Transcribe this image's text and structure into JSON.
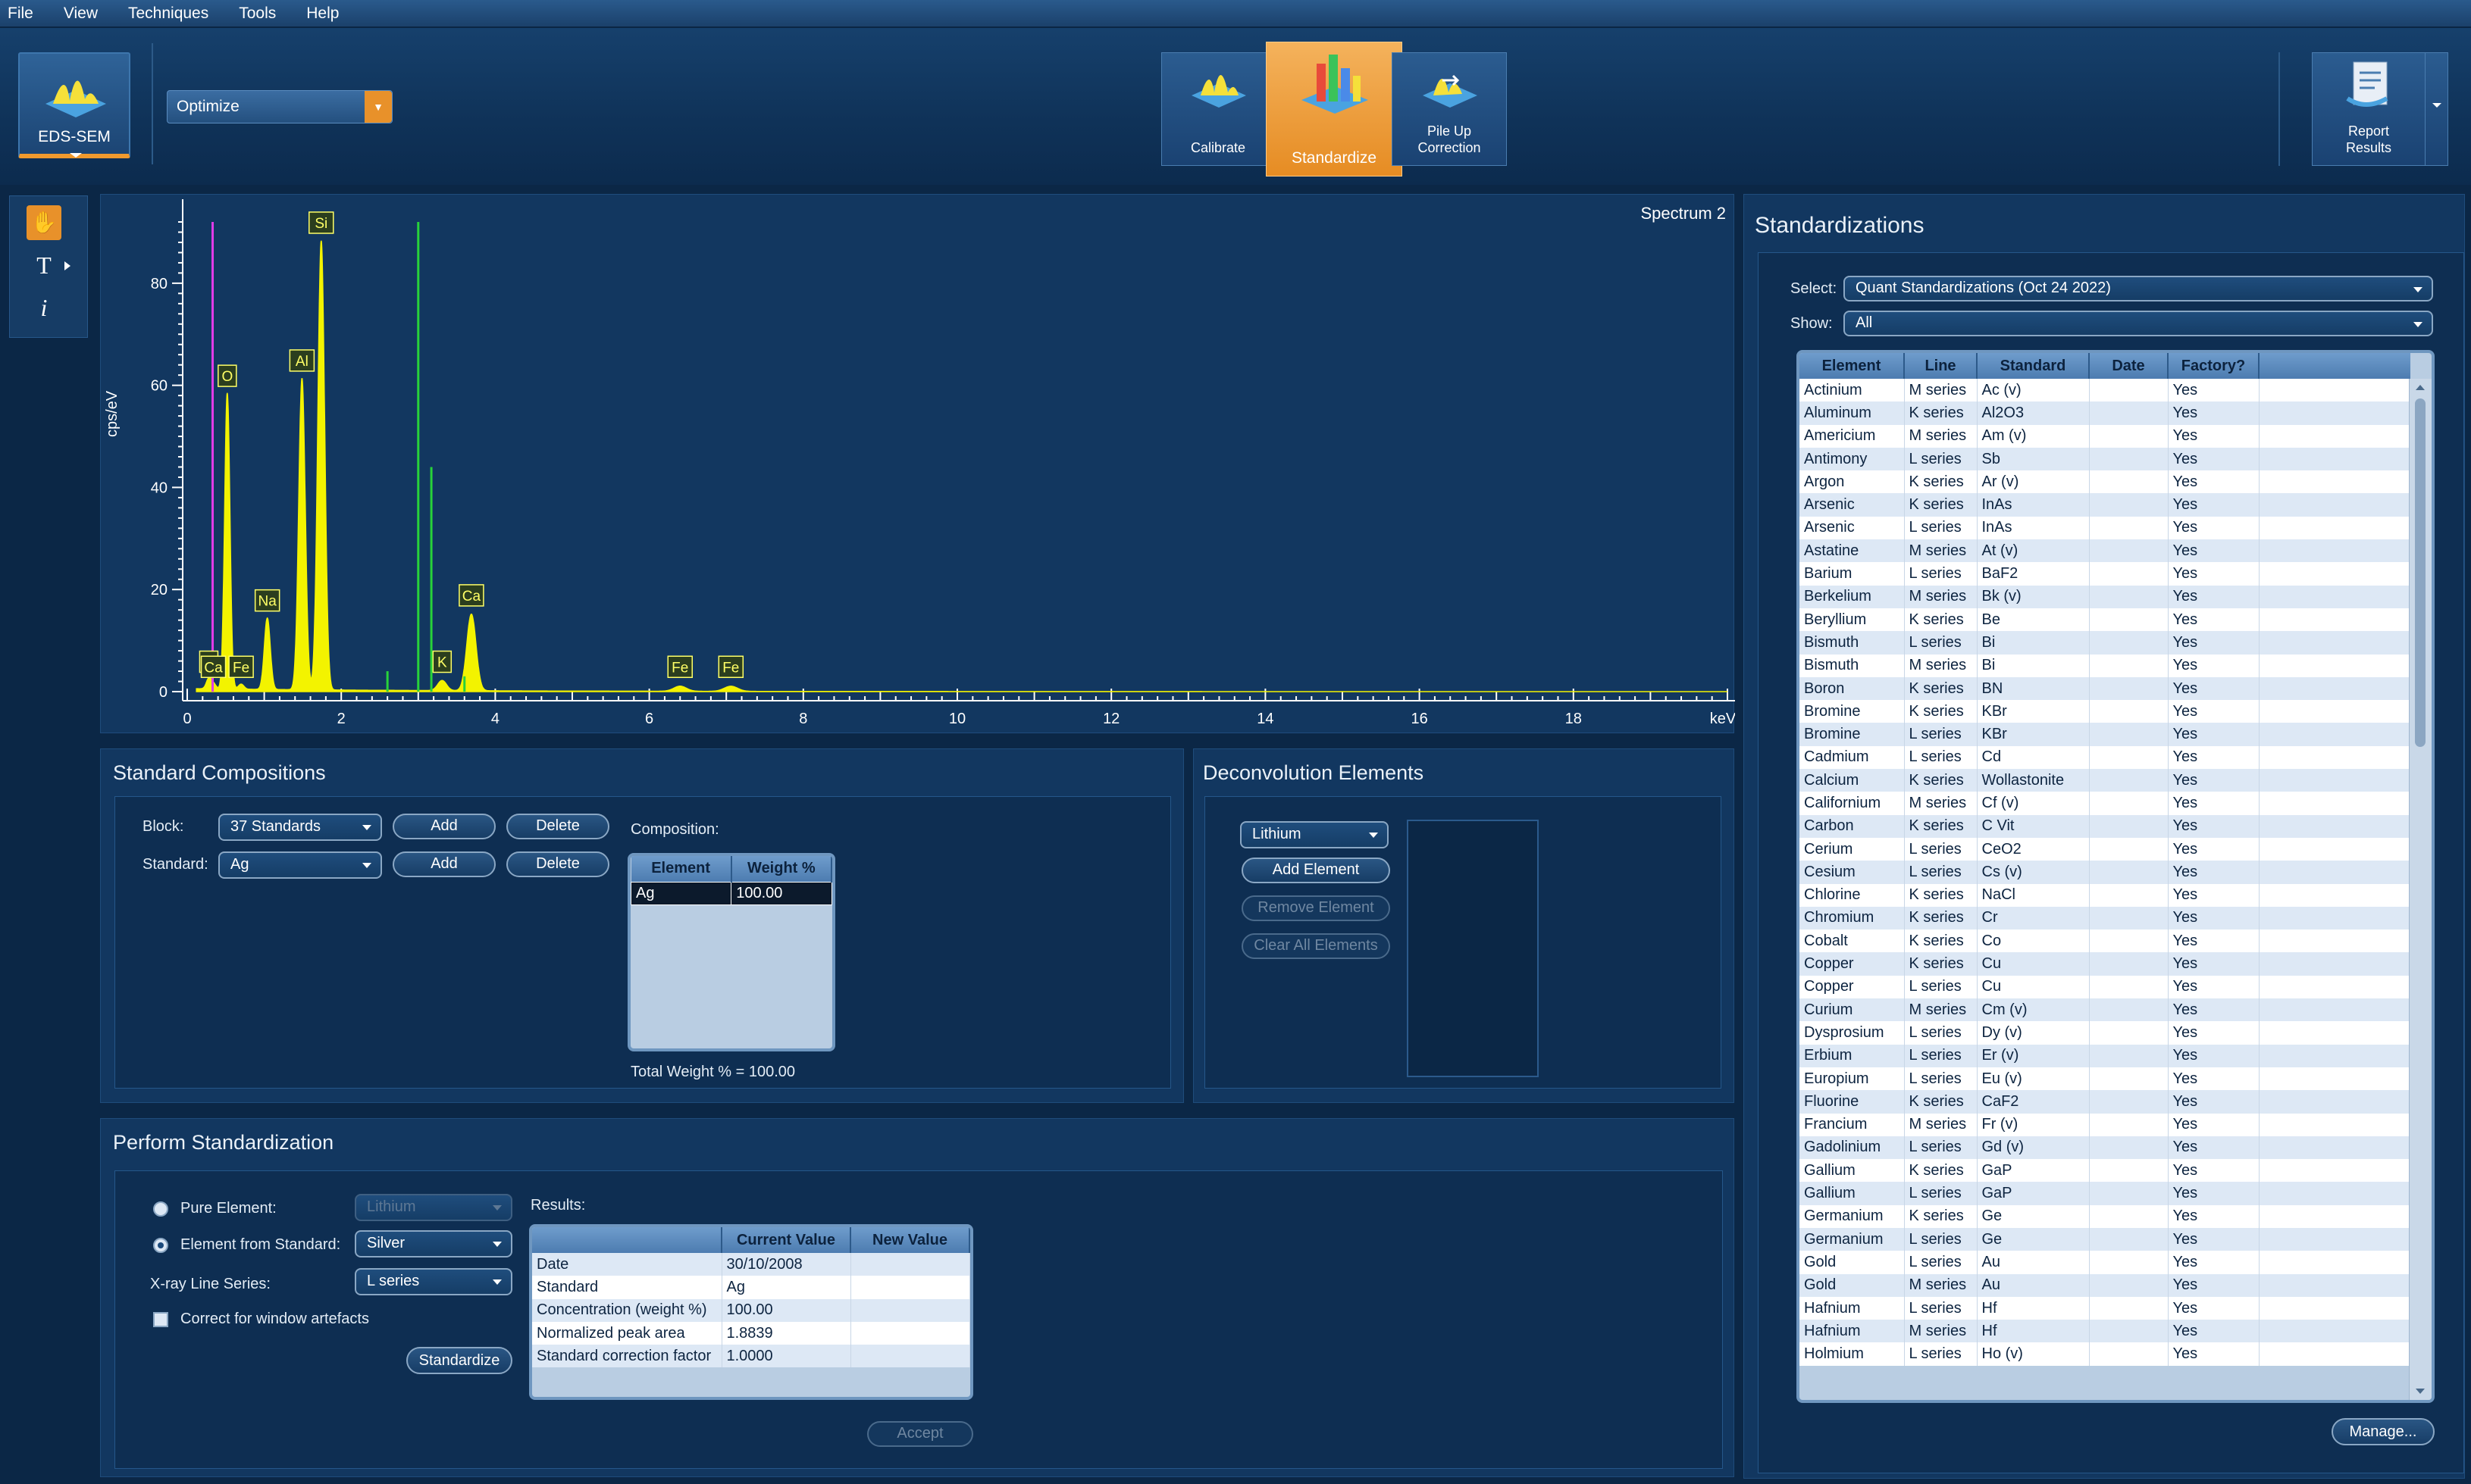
{
  "menu": [
    "File",
    "View",
    "Techniques",
    "Tools",
    "Help"
  ],
  "app_button": {
    "label": "EDS-SEM"
  },
  "optimize_combo": {
    "value": "Optimize"
  },
  "ribbon": {
    "calibrate": "Calibrate",
    "standardize": "Standardize",
    "pileup_line1": "Pile Up",
    "pileup_line2": "Correction",
    "report_line1": "Report",
    "report_line2": "Results"
  },
  "spectrum": {
    "title": "Spectrum 2",
    "ylabel": "cps/eV",
    "xunit": "keV",
    "xticks": [
      "0",
      "2",
      "4",
      "6",
      "8",
      "10",
      "12",
      "14",
      "16",
      "18"
    ],
    "yticks": [
      "0",
      "20",
      "40",
      "60",
      "80"
    ],
    "peak_labels": [
      "Si",
      "O",
      "Al",
      "Na",
      "Ca",
      "C",
      "Ca",
      "Fe",
      "K",
      "Fe",
      "Fe"
    ]
  },
  "chart_data": {
    "type": "line",
    "title": "Spectrum 2",
    "xlabel": "keV",
    "ylabel": "cps/eV",
    "xlim": [
      0,
      20
    ],
    "ylim": [
      0,
      92
    ],
    "peaks": [
      {
        "label": "C",
        "x": 0.28,
        "y": 2
      },
      {
        "label": "Ca",
        "x": 0.34,
        "y": 1
      },
      {
        "label": "O",
        "x": 0.52,
        "y": 58
      },
      {
        "label": "Fe",
        "x": 0.7,
        "y": 1
      },
      {
        "label": "Na",
        "x": 1.04,
        "y": 14
      },
      {
        "label": "Al",
        "x": 1.49,
        "y": 61
      },
      {
        "label": "Si",
        "x": 1.74,
        "y": 88
      },
      {
        "label": "K",
        "x": 3.31,
        "y": 2
      },
      {
        "label": "Ca",
        "x": 3.69,
        "y": 15
      },
      {
        "label": "Fe",
        "x": 6.4,
        "y": 1
      },
      {
        "label": "Fe",
        "x": 7.06,
        "y": 1
      }
    ],
    "marker_lines": [
      {
        "x": 0.33,
        "color": "#e23ce8",
        "y": 92
      },
      {
        "x": 3.0,
        "color": "#28d23a",
        "y": 92
      },
      {
        "x": 3.17,
        "color": "#28d23a",
        "y": 44
      },
      {
        "x": 2.6,
        "color": "#28d23a",
        "y": 4
      },
      {
        "x": 3.6,
        "color": "#28d23a",
        "y": 3
      }
    ]
  },
  "std_comp": {
    "title": "Standard Compositions",
    "block_label": "Block:",
    "block_value": "37 Standards",
    "standard_label": "Standard:",
    "standard_value": "Ag",
    "add": "Add",
    "delete": "Delete",
    "composition_label": "Composition:",
    "comp_headers": [
      "Element",
      "Weight %"
    ],
    "comp_rows": [
      [
        "Ag",
        "100.00"
      ]
    ],
    "total": "Total Weight % = 100.00"
  },
  "deconv": {
    "title": "Deconvolution Elements",
    "element_value": "Lithium",
    "add": "Add Element",
    "remove": "Remove Element",
    "clear": "Clear All Elements"
  },
  "perform": {
    "title": "Perform Standardization",
    "pure_label": "Pure Element:",
    "pure_value": "Lithium",
    "efs_label": "Element from Standard:",
    "efs_value": "Silver",
    "xray_label": "X-ray Line Series:",
    "xray_value": "L series",
    "correct_label": "Correct for window artefacts",
    "standardize_btn": "Standardize",
    "results_label": "Results:",
    "res_headers": [
      "",
      "Current Value",
      "New Value"
    ],
    "res_rows": [
      [
        "Date",
        "30/10/2008",
        ""
      ],
      [
        "Standard",
        "Ag",
        ""
      ],
      [
        "Concentration (weight %)",
        "100.00",
        ""
      ],
      [
        "Normalized peak area",
        "1.8839",
        ""
      ],
      [
        "Standard correction factor",
        "1.0000",
        ""
      ]
    ],
    "accept": "Accept"
  },
  "standardizations": {
    "title": "Standardizations",
    "select_label": "Select:",
    "select_value": "Quant Standardizations (Oct 24 2022)",
    "show_label": "Show:",
    "show_value": "All",
    "headers": [
      "Element",
      "Line",
      "Standard",
      "Date",
      "Factory?"
    ],
    "rows": [
      [
        "Actinium",
        "M series",
        "Ac (v)",
        "",
        "Yes"
      ],
      [
        "Aluminum",
        "K series",
        "Al2O3",
        "",
        "Yes"
      ],
      [
        "Americium",
        "M series",
        "Am (v)",
        "",
        "Yes"
      ],
      [
        "Antimony",
        "L series",
        "Sb",
        "",
        "Yes"
      ],
      [
        "Argon",
        "K series",
        "Ar (v)",
        "",
        "Yes"
      ],
      [
        "Arsenic",
        "K series",
        "InAs",
        "",
        "Yes"
      ],
      [
        "Arsenic",
        "L series",
        "InAs",
        "",
        "Yes"
      ],
      [
        "Astatine",
        "M series",
        "At (v)",
        "",
        "Yes"
      ],
      [
        "Barium",
        "L series",
        "BaF2",
        "",
        "Yes"
      ],
      [
        "Berkelium",
        "M series",
        "Bk (v)",
        "",
        "Yes"
      ],
      [
        "Beryllium",
        "K series",
        "Be",
        "",
        "Yes"
      ],
      [
        "Bismuth",
        "L series",
        "Bi",
        "",
        "Yes"
      ],
      [
        "Bismuth",
        "M series",
        "Bi",
        "",
        "Yes"
      ],
      [
        "Boron",
        "K series",
        "BN",
        "",
        "Yes"
      ],
      [
        "Bromine",
        "K series",
        "KBr",
        "",
        "Yes"
      ],
      [
        "Bromine",
        "L series",
        "KBr",
        "",
        "Yes"
      ],
      [
        "Cadmium",
        "L series",
        "Cd",
        "",
        "Yes"
      ],
      [
        "Calcium",
        "K series",
        "Wollastonite",
        "",
        "Yes"
      ],
      [
        "Californium",
        "M series",
        "Cf (v)",
        "",
        "Yes"
      ],
      [
        "Carbon",
        "K series",
        "C Vit",
        "",
        "Yes"
      ],
      [
        "Cerium",
        "L series",
        "CeO2",
        "",
        "Yes"
      ],
      [
        "Cesium",
        "L series",
        "Cs (v)",
        "",
        "Yes"
      ],
      [
        "Chlorine",
        "K series",
        "NaCl",
        "",
        "Yes"
      ],
      [
        "Chromium",
        "K series",
        "Cr",
        "",
        "Yes"
      ],
      [
        "Cobalt",
        "K series",
        "Co",
        "",
        "Yes"
      ],
      [
        "Copper",
        "K series",
        "Cu",
        "",
        "Yes"
      ],
      [
        "Copper",
        "L series",
        "Cu",
        "",
        "Yes"
      ],
      [
        "Curium",
        "M series",
        "Cm (v)",
        "",
        "Yes"
      ],
      [
        "Dysprosium",
        "L series",
        "Dy (v)",
        "",
        "Yes"
      ],
      [
        "Erbium",
        "L series",
        "Er (v)",
        "",
        "Yes"
      ],
      [
        "Europium",
        "L series",
        "Eu (v)",
        "",
        "Yes"
      ],
      [
        "Fluorine",
        "K series",
        "CaF2",
        "",
        "Yes"
      ],
      [
        "Francium",
        "M series",
        "Fr (v)",
        "",
        "Yes"
      ],
      [
        "Gadolinium",
        "L series",
        "Gd (v)",
        "",
        "Yes"
      ],
      [
        "Gallium",
        "K series",
        "GaP",
        "",
        "Yes"
      ],
      [
        "Gallium",
        "L series",
        "GaP",
        "",
        "Yes"
      ],
      [
        "Germanium",
        "K series",
        "Ge",
        "",
        "Yes"
      ],
      [
        "Germanium",
        "L series",
        "Ge",
        "",
        "Yes"
      ],
      [
        "Gold",
        "L series",
        "Au",
        "",
        "Yes"
      ],
      [
        "Gold",
        "M series",
        "Au",
        "",
        "Yes"
      ],
      [
        "Hafnium",
        "L series",
        "Hf",
        "",
        "Yes"
      ],
      [
        "Hafnium",
        "M series",
        "Hf",
        "",
        "Yes"
      ],
      [
        "Holmium",
        "L series",
        "Ho (v)",
        "",
        "Yes"
      ]
    ],
    "manage": "Manage..."
  },
  "colors": {
    "accent": "#e8912a",
    "spectrum": "#f3f300",
    "background": "#0b2746"
  },
  "icons": [
    "hand-tool-icon",
    "text-tool-icon",
    "info-tool-icon",
    "chevron-down-icon"
  ]
}
